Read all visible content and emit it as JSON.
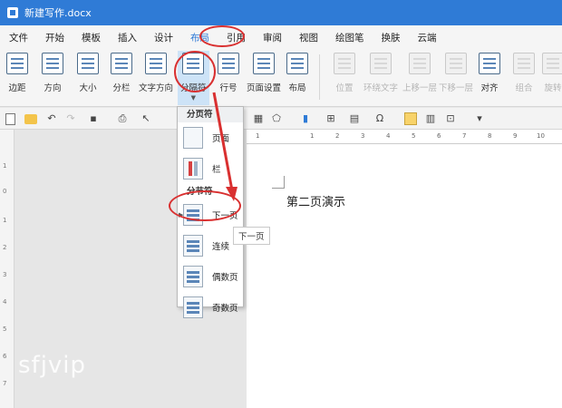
{
  "window": {
    "title": "新建写作.docx"
  },
  "menu": [
    "文件",
    "开始",
    "模板",
    "插入",
    "设计",
    "布局",
    "引用",
    "审阅",
    "视图",
    "绘图笔",
    "换肤",
    "云端"
  ],
  "menu_active_index": 5,
  "ribbon": {
    "margin": "边距",
    "orientation": "方向",
    "size": "大小",
    "columns": "分栏",
    "text_direction": "文字方向",
    "breaks": "分隔符",
    "line_numbers": "行号",
    "page_setup": "页面设置",
    "layout": "布局",
    "position": "位置",
    "wrap_text": "环绕文字",
    "bring_forward": "上移一层",
    "send_backward": "下移一层",
    "align": "对齐",
    "group": "组合",
    "rotate": "旋转"
  },
  "ruler": {
    "top_ticks": [
      "1",
      "1",
      "2",
      "3",
      "4",
      "5",
      "6",
      "7",
      "8",
      "9",
      "10"
    ],
    "left_ticks": [
      "1",
      "0",
      "1",
      "2",
      "3",
      "4",
      "5",
      "6",
      "7",
      "8",
      "9"
    ]
  },
  "dropdown": {
    "page_break_header": "分页符",
    "section_break_header": "分节符",
    "items": [
      {
        "label": "页面"
      },
      {
        "label": "栏"
      },
      {
        "label": "下一页"
      },
      {
        "label": "连续"
      },
      {
        "label": "偶数页"
      },
      {
        "label": "奇数页"
      }
    ]
  },
  "tooltip": "下一页",
  "document": {
    "text": "第二页演示"
  },
  "watermark": "sfjvip",
  "colors": {
    "title_bar": "#2f7bd6",
    "annotation": "#d93030",
    "accent": "#2f7bd6"
  }
}
